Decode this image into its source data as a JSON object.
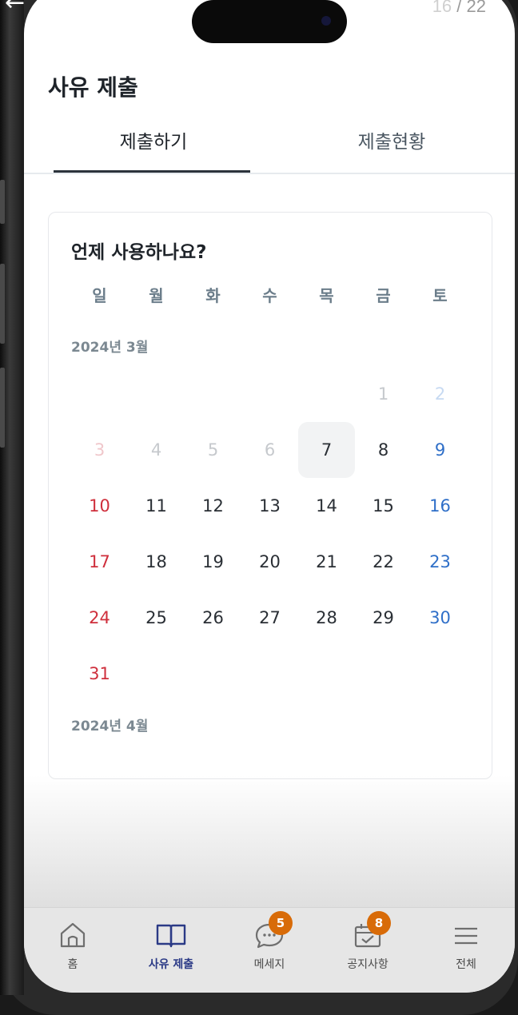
{
  "overlay": {
    "counter_current": "16",
    "counter_total": "/ 22",
    "back_arrow": "←"
  },
  "header": {
    "title": "사유 제출"
  },
  "tabs": [
    {
      "label": "제출하기",
      "active": true
    },
    {
      "label": "제출현황",
      "active": false
    }
  ],
  "calendar": {
    "question": "언제 사용하나요?",
    "weekdays": [
      "일",
      "월",
      "화",
      "수",
      "목",
      "금",
      "토"
    ],
    "months": [
      {
        "label": "2024년 3월",
        "today": 7,
        "days": [
          "",
          "",
          "",
          "",
          "",
          "1",
          "2",
          "3",
          "4",
          "5",
          "6",
          "7",
          "8",
          "9",
          "10",
          "11",
          "12",
          "13",
          "14",
          "15",
          "16",
          "17",
          "18",
          "19",
          "20",
          "21",
          "22",
          "23",
          "24",
          "25",
          "26",
          "27",
          "28",
          "29",
          "30",
          "31"
        ]
      },
      {
        "label": "2024년 4월"
      }
    ]
  },
  "bottom_nav": [
    {
      "label": "홈",
      "icon": "home-icon",
      "active": false,
      "badge": ""
    },
    {
      "label": "사유 제출",
      "icon": "book-icon",
      "active": true,
      "badge": ""
    },
    {
      "label": "메세지",
      "icon": "chat-icon",
      "active": false,
      "badge": "5"
    },
    {
      "label": "공지사항",
      "icon": "calendar-check-icon",
      "active": false,
      "badge": "8"
    },
    {
      "label": "전체",
      "icon": "menu-icon",
      "active": false,
      "badge": ""
    }
  ],
  "colors": {
    "sunday": "#cf2f3c",
    "saturday": "#2f6fc8",
    "badge": "#d86b08",
    "active_nav": "#2b3a86"
  }
}
